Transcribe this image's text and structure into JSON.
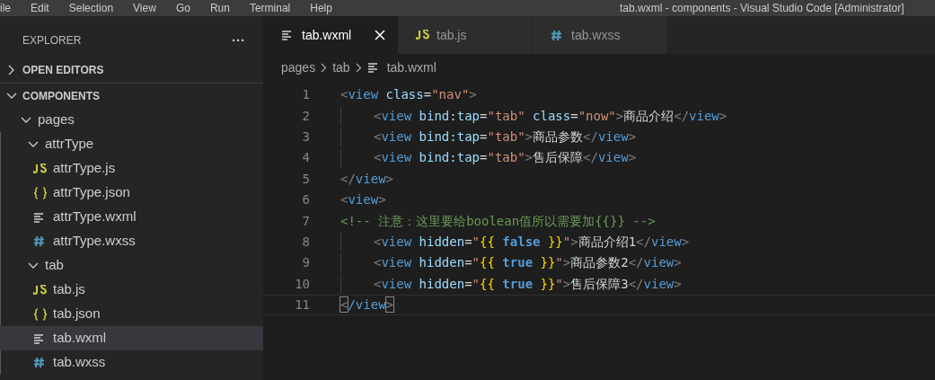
{
  "menu_bar": {
    "items": [
      "ile",
      "Edit",
      "Selection",
      "View",
      "Go",
      "Run",
      "Terminal",
      "Help"
    ],
    "title": "tab.wxml - components - Visual Studio Code [Administrator]"
  },
  "sidebar": {
    "title": "EXPLORER",
    "more": "···",
    "sections": [
      {
        "label": "OPEN EDITORS",
        "expanded": false
      },
      {
        "label": "COMPONENTS",
        "expanded": true,
        "children": [
          {
            "label": "pages",
            "kind": "folder",
            "expanded": true,
            "children": [
              {
                "label": "attrType",
                "kind": "folder",
                "expanded": true,
                "children": [
                  {
                    "label": "attrType.js",
                    "kind": "js",
                    "selected": false
                  },
                  {
                    "label": "attrType.json",
                    "kind": "json",
                    "selected": false
                  },
                  {
                    "label": "attrType.wxml",
                    "kind": "wxml",
                    "selected": false
                  },
                  {
                    "label": "attrType.wxss",
                    "kind": "wxss",
                    "selected": false
                  }
                ]
              },
              {
                "label": "tab",
                "kind": "folder",
                "expanded": true,
                "children": [
                  {
                    "label": "tab.js",
                    "kind": "js",
                    "selected": false
                  },
                  {
                    "label": "tab.json",
                    "kind": "json",
                    "selected": false
                  },
                  {
                    "label": "tab.wxml",
                    "kind": "wxml",
                    "selected": true
                  },
                  {
                    "label": "tab.wxss",
                    "kind": "wxss",
                    "selected": false
                  }
                ]
              }
            ]
          }
        ]
      }
    ]
  },
  "tabs": [
    {
      "label": "tab.wxml",
      "kind": "wxml",
      "selected": true
    },
    {
      "label": "tab.js",
      "kind": "js",
      "selected": false
    },
    {
      "label": "tab.wxss",
      "kind": "wxss",
      "selected": false
    }
  ],
  "breadcrumb": [
    {
      "label": "pages",
      "kind": "folder"
    },
    {
      "label": "tab",
      "kind": "folder"
    },
    {
      "label": "tab.wxml",
      "kind": "wxml"
    }
  ],
  "code": [
    {
      "number": "1",
      "indented": false,
      "current": false,
      "tokens": [
        {
          "kind": "punct",
          "text": "<"
        },
        {
          "kind": "tag",
          "text": "view"
        },
        {
          "kind": "attr",
          "text": " class"
        },
        {
          "kind": "plain",
          "text": "="
        },
        {
          "kind": "string",
          "text": "\"nav\""
        },
        {
          "kind": "punct",
          "text": ">"
        }
      ]
    },
    {
      "number": "2",
      "indented": true,
      "current": false,
      "tokens": [
        {
          "kind": "punct",
          "text": "<"
        },
        {
          "kind": "tag",
          "text": "view"
        },
        {
          "kind": "attr",
          "text": " bind:tap"
        },
        {
          "kind": "plain",
          "text": "="
        },
        {
          "kind": "string",
          "text": "\"tab\""
        },
        {
          "kind": "attr",
          "text": " class"
        },
        {
          "kind": "plain",
          "text": "="
        },
        {
          "kind": "string",
          "text": "\"now\""
        },
        {
          "kind": "punct",
          "text": ">"
        },
        {
          "kind": "plain",
          "text": "商品介绍"
        },
        {
          "kind": "punct",
          "text": "</"
        },
        {
          "kind": "tag",
          "text": "view"
        },
        {
          "kind": "punct",
          "text": ">"
        }
      ]
    },
    {
      "number": "3",
      "indented": true,
      "current": false,
      "tokens": [
        {
          "kind": "punct",
          "text": "<"
        },
        {
          "kind": "tag",
          "text": "view"
        },
        {
          "kind": "attr",
          "text": " bind:tap"
        },
        {
          "kind": "plain",
          "text": "="
        },
        {
          "kind": "string",
          "text": "\"tab\""
        },
        {
          "kind": "punct",
          "text": ">"
        },
        {
          "kind": "plain",
          "text": "商品参数"
        },
        {
          "kind": "punct",
          "text": "</"
        },
        {
          "kind": "tag",
          "text": "view"
        },
        {
          "kind": "punct",
          "text": ">"
        }
      ]
    },
    {
      "number": "4",
      "indented": true,
      "current": false,
      "tokens": [
        {
          "kind": "punct",
          "text": "<"
        },
        {
          "kind": "tag",
          "text": "view"
        },
        {
          "kind": "attr",
          "text": " bind:tap"
        },
        {
          "kind": "plain",
          "text": "="
        },
        {
          "kind": "string",
          "text": "\"tab\""
        },
        {
          "kind": "punct",
          "text": ">"
        },
        {
          "kind": "plain",
          "text": "售后保障"
        },
        {
          "kind": "punct",
          "text": "</"
        },
        {
          "kind": "tag",
          "text": "view"
        },
        {
          "kind": "punct",
          "text": ">"
        }
      ]
    },
    {
      "number": "5",
      "indented": false,
      "current": false,
      "tokens": [
        {
          "kind": "punct",
          "text": "</"
        },
        {
          "kind": "tag",
          "text": "view"
        },
        {
          "kind": "punct",
          "text": ">"
        }
      ]
    },
    {
      "number": "6",
      "indented": false,
      "current": false,
      "tokens": [
        {
          "kind": "punct",
          "text": "<"
        },
        {
          "kind": "tag",
          "text": "view"
        },
        {
          "kind": "punct",
          "text": ">"
        }
      ]
    },
    {
      "number": "7",
      "indented": false,
      "current": false,
      "tokens": [
        {
          "kind": "comment",
          "text": "<!-- 注意：这里要给boolean值所以需要加{{}} -->"
        }
      ]
    },
    {
      "number": "8",
      "indented": true,
      "current": false,
      "tokens": [
        {
          "kind": "punct",
          "text": "<"
        },
        {
          "kind": "tag",
          "text": "view"
        },
        {
          "kind": "attr",
          "text": " hidden"
        },
        {
          "kind": "plain",
          "text": "="
        },
        {
          "kind": "string",
          "text": "\""
        },
        {
          "kind": "brace",
          "text": "{{ "
        },
        {
          "kind": "keyword",
          "text": "false"
        },
        {
          "kind": "brace",
          "text": " }}"
        },
        {
          "kind": "string",
          "text": "\""
        },
        {
          "kind": "punct",
          "text": ">"
        },
        {
          "kind": "plain",
          "text": "商品介绍1"
        },
        {
          "kind": "punct",
          "text": "</"
        },
        {
          "kind": "tag",
          "text": "view"
        },
        {
          "kind": "punct",
          "text": ">"
        }
      ]
    },
    {
      "number": "9",
      "indented": true,
      "current": false,
      "tokens": [
        {
          "kind": "punct",
          "text": "<"
        },
        {
          "kind": "tag",
          "text": "view"
        },
        {
          "kind": "attr",
          "text": " hidden"
        },
        {
          "kind": "plain",
          "text": "="
        },
        {
          "kind": "string",
          "text": "\""
        },
        {
          "kind": "brace",
          "text": "{{ "
        },
        {
          "kind": "keyword",
          "text": "true"
        },
        {
          "kind": "brace",
          "text": " }}"
        },
        {
          "kind": "string",
          "text": "\""
        },
        {
          "kind": "punct",
          "text": ">"
        },
        {
          "kind": "plain",
          "text": "商品参数2"
        },
        {
          "kind": "punct",
          "text": "</"
        },
        {
          "kind": "tag",
          "text": "view"
        },
        {
          "kind": "punct",
          "text": ">"
        }
      ]
    },
    {
      "number": "10",
      "indented": true,
      "current": false,
      "tokens": [
        {
          "kind": "punct",
          "text": "<"
        },
        {
          "kind": "tag",
          "text": "view"
        },
        {
          "kind": "attr",
          "text": " hidden"
        },
        {
          "kind": "plain",
          "text": "="
        },
        {
          "kind": "string",
          "text": "\""
        },
        {
          "kind": "brace",
          "text": "{{ "
        },
        {
          "kind": "keyword",
          "text": "true"
        },
        {
          "kind": "brace",
          "text": " }}"
        },
        {
          "kind": "string",
          "text": "\""
        },
        {
          "kind": "punct",
          "text": ">"
        },
        {
          "kind": "plain",
          "text": "售后保障3"
        },
        {
          "kind": "punct",
          "text": "</"
        },
        {
          "kind": "tag",
          "text": "view"
        },
        {
          "kind": "punct",
          "text": ">"
        }
      ]
    },
    {
      "number": "11",
      "indented": false,
      "current": true,
      "tokens": [
        {
          "kind": "match",
          "text": "<"
        },
        {
          "kind": "tag",
          "text": "/view"
        },
        {
          "kind": "match",
          "text": ">"
        }
      ]
    }
  ]
}
